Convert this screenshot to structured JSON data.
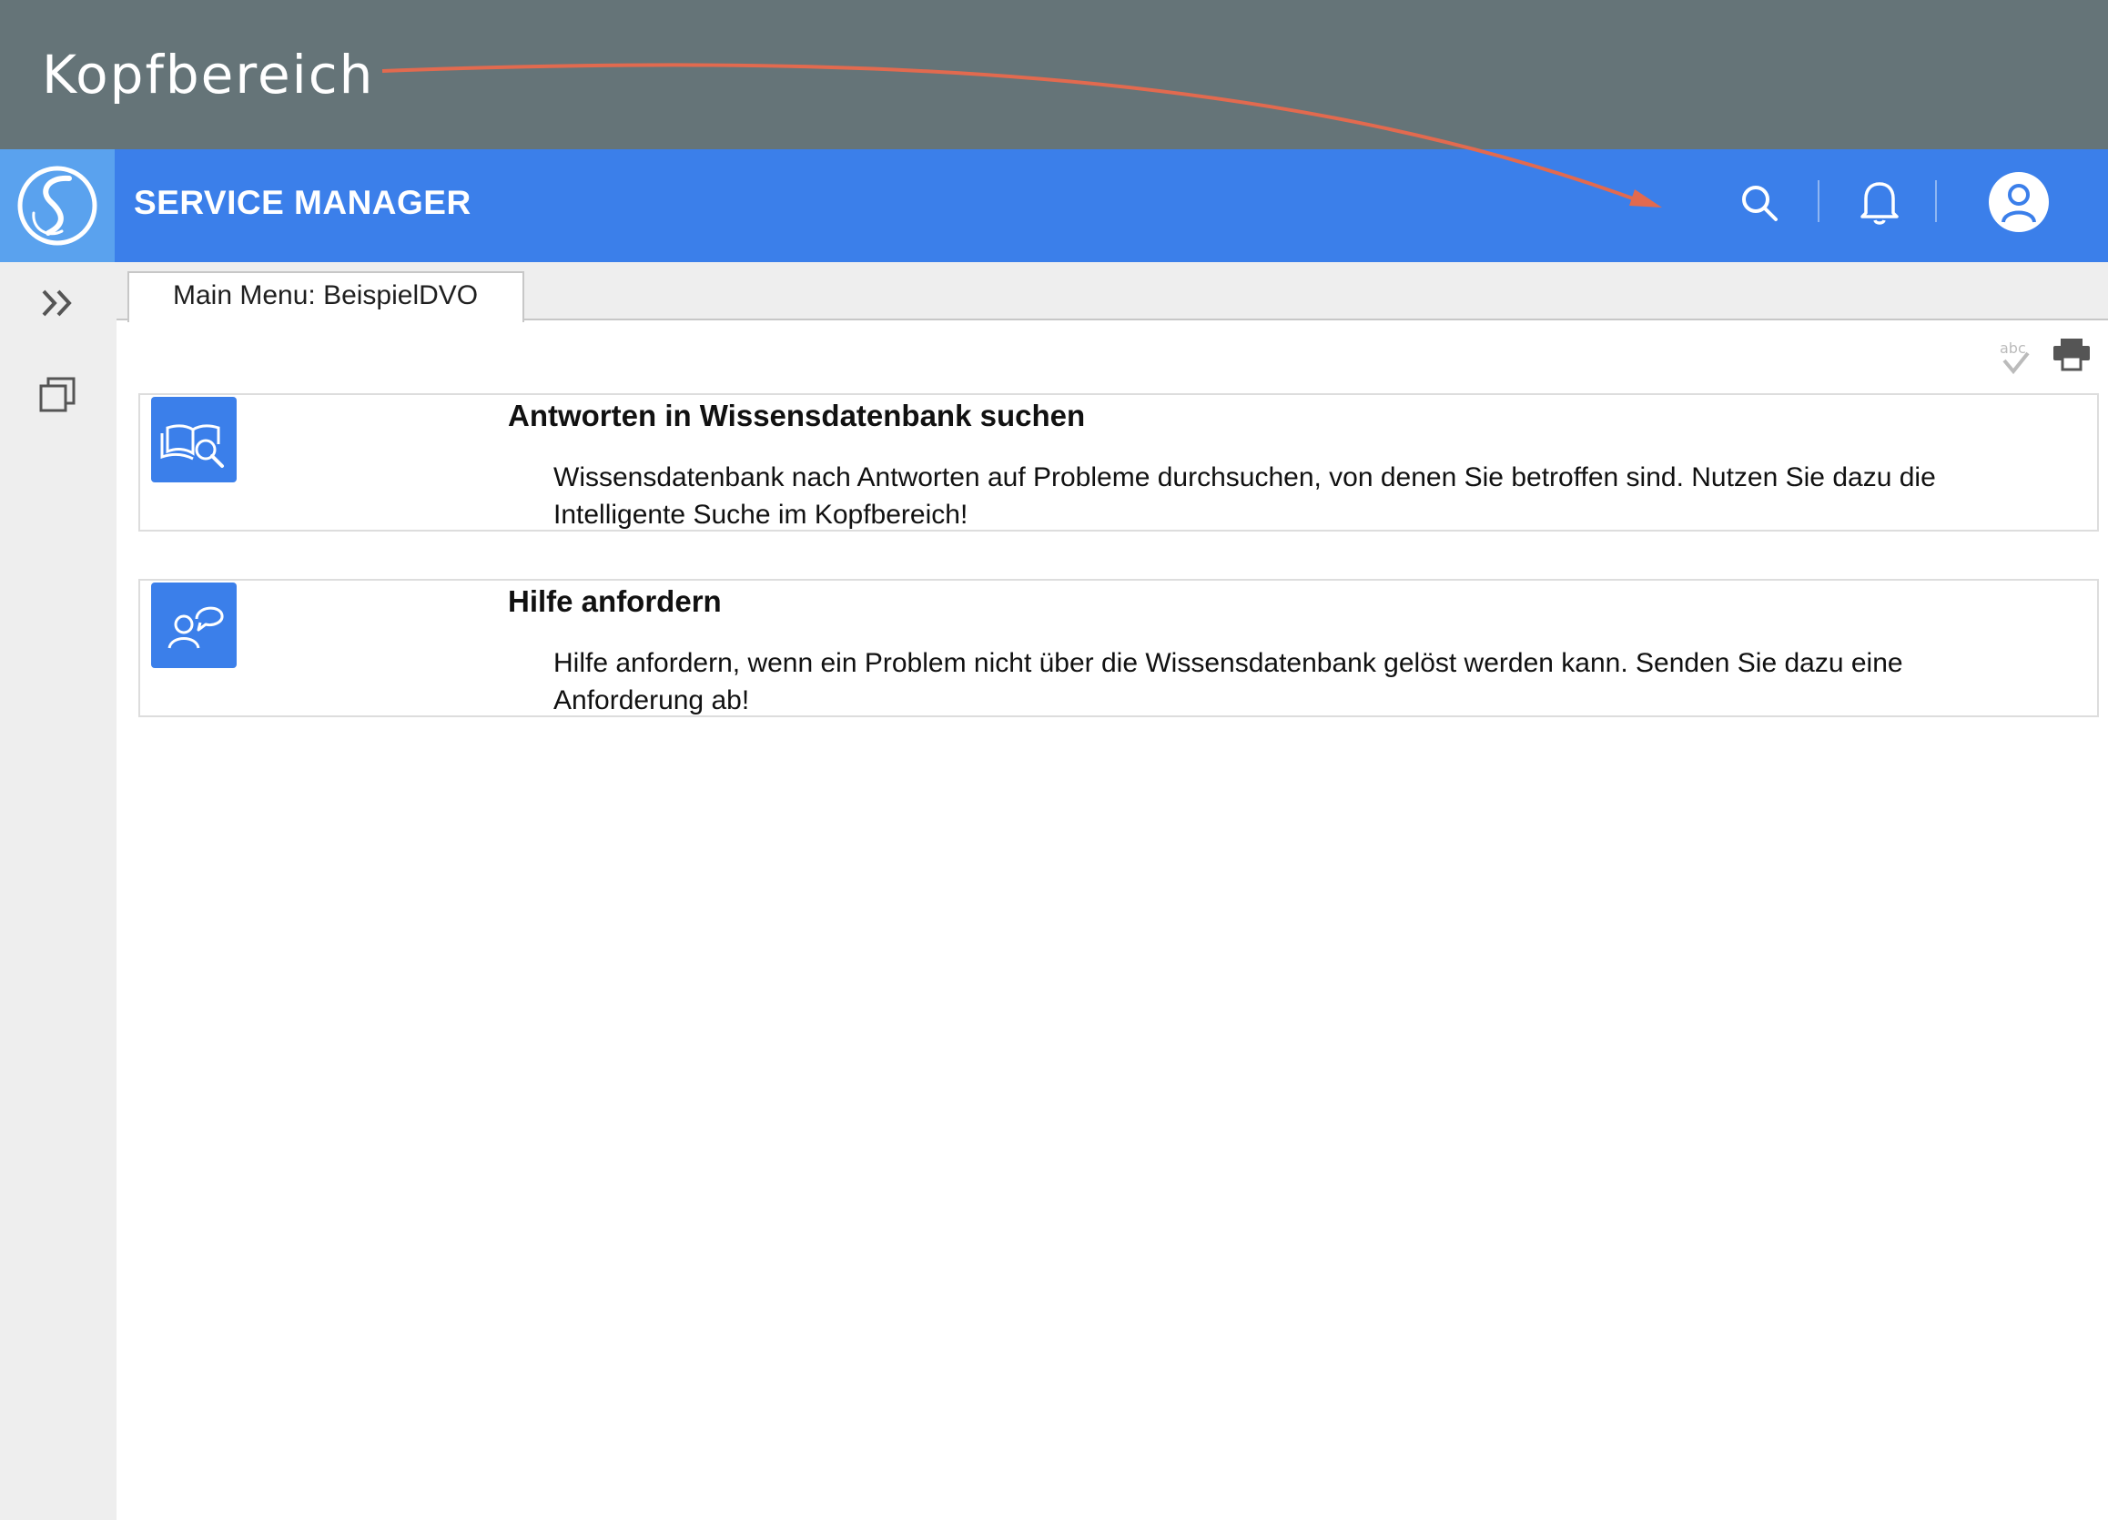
{
  "annotation": {
    "label": "Kopfbereich",
    "arrow_color": "#e26a4f",
    "banner_color": "#657478"
  },
  "header": {
    "app_title": "SERVICE MANAGER",
    "background": "#3b7fea",
    "icons": [
      "app-logo-icon",
      "search-icon",
      "bell-icon",
      "user-icon"
    ]
  },
  "sidebar": {
    "icons": [
      "expand-chevrons-icon",
      "windows-icon"
    ]
  },
  "tabs": [
    {
      "label": "Main Menu: BeispielDVO",
      "active": true
    }
  ],
  "toolbar": {
    "icons": [
      "spellcheck-icon",
      "print-icon"
    ]
  },
  "cards": [
    {
      "icon": "knowledge-search-icon",
      "title": "Antworten in Wissensdatenbank suchen",
      "description": "Wissensdatenbank nach Antworten auf Probleme durchsuchen, von denen Sie betroffen sind. Nutzen Sie dazu die Intelligente Suche im Kopfbereich!"
    },
    {
      "icon": "request-help-icon",
      "title": "Hilfe anfordern",
      "description": "Hilfe anfordern, wenn ein Problem nicht über die Wissensdatenbank gelöst werden kann. Senden Sie dazu eine Anforderung ab!"
    }
  ]
}
